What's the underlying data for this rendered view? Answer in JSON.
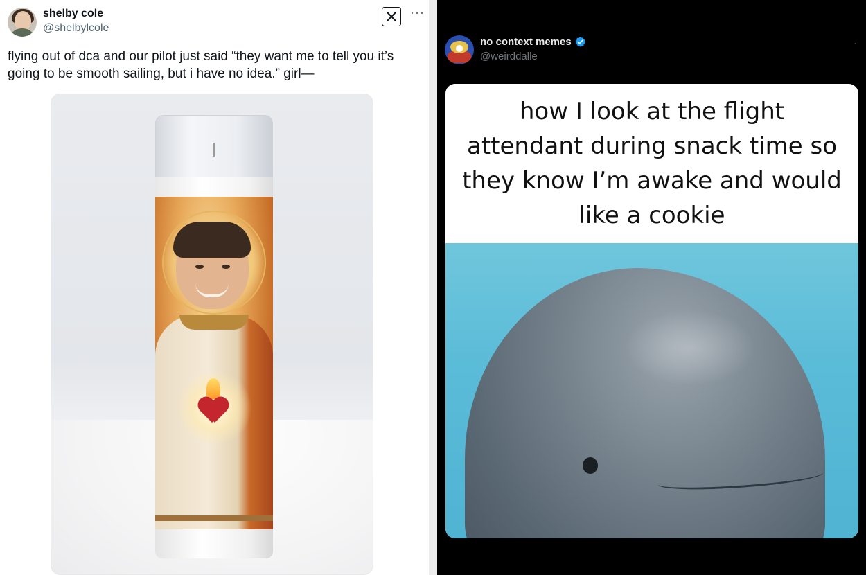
{
  "left_tweet": {
    "author_name": "shelby cole",
    "author_handle": "@shelbylcole",
    "text": "flying out of dca and our pilot just said “they want me to tell you it’s going to be smooth sailing, but i have no idea.” girl—",
    "more_label": "···",
    "badge_icon": "x-logo-icon",
    "media_icon": "saint-candle-photo"
  },
  "right_tweet": {
    "author_name": "no context memes",
    "author_handle": "@weirddalle",
    "verified": true,
    "more_label": "·",
    "caption": "how I look at the flight attendant during snack time so they know I’m awake and would like a cookie",
    "media_icon": "beluga-whale-photo"
  },
  "colors": {
    "left_bg": "#ffffff",
    "right_bg": "#000000",
    "verified_blue": "#1d9bf0",
    "text_dark": "#0f1419",
    "text_light": "#e7e9ea",
    "handle_gray": "#536471"
  }
}
